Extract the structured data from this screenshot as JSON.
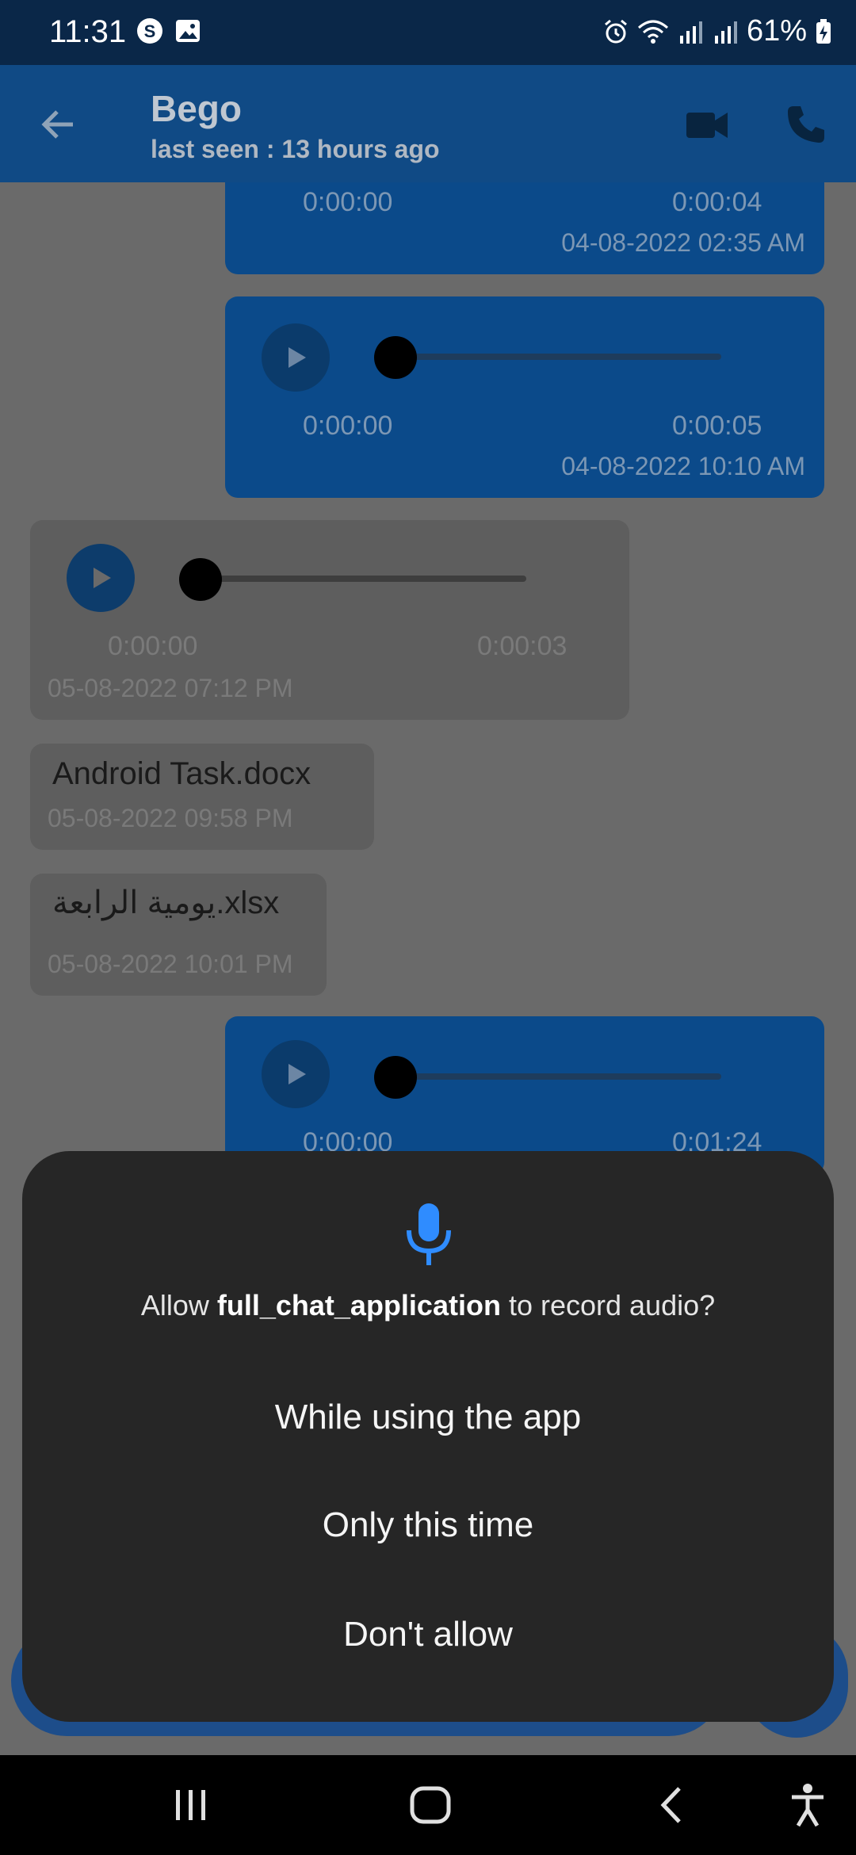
{
  "status_bar": {
    "time": "11:31",
    "battery": "61%"
  },
  "app_bar": {
    "contact_name": "Bego",
    "last_seen": "last seen : 13 hours ago"
  },
  "messages": [
    {
      "type": "audio",
      "direction": "sent",
      "start": "0:00:00",
      "end": "0:00:04",
      "timestamp": "04-08-2022 02:35 AM"
    },
    {
      "type": "audio",
      "direction": "sent",
      "start": "0:00:00",
      "end": "0:00:05",
      "timestamp": "04-08-2022 10:10 AM"
    },
    {
      "type": "audio",
      "direction": "received",
      "start": "0:00:00",
      "end": "0:00:03",
      "timestamp": "05-08-2022 07:12 PM"
    },
    {
      "type": "file",
      "direction": "received",
      "name": "Android Task.docx",
      "timestamp": "05-08-2022 09:58 PM"
    },
    {
      "type": "file",
      "direction": "received",
      "name": "يومية الرابعة.xlsx",
      "timestamp": "05-08-2022 10:01 PM"
    },
    {
      "type": "audio",
      "direction": "sent",
      "start": "0:00:00",
      "end": "0:01:24",
      "timestamp": ""
    }
  ],
  "dialog": {
    "prefix": "Allow ",
    "app_name": "full_chat_application",
    "suffix": " to record audio?",
    "options": [
      "While using the app",
      "Only this time",
      "Don't allow"
    ]
  },
  "colors": {
    "app_bar": "#104a85",
    "sent_bubble": "#0b4a8a",
    "dialog_bg": "#262626",
    "mic_accent": "#2f8cff"
  }
}
